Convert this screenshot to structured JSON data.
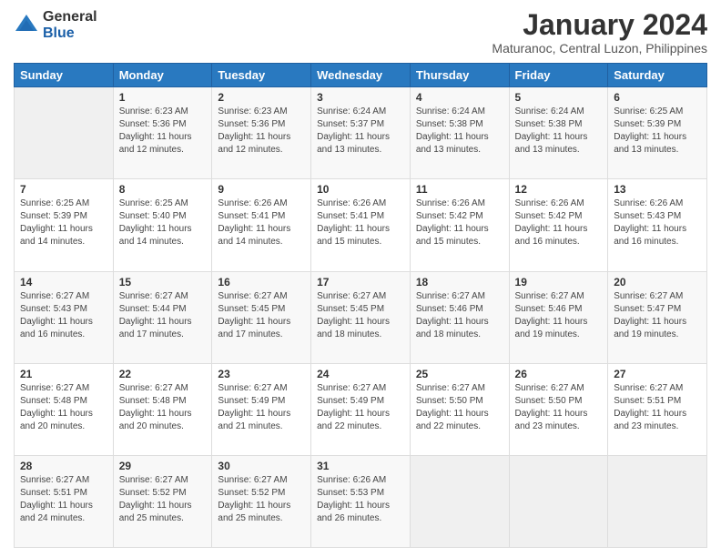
{
  "logo": {
    "general": "General",
    "blue": "Blue"
  },
  "title": "January 2024",
  "subtitle": "Maturanoc, Central Luzon, Philippines",
  "days_header": [
    "Sunday",
    "Monday",
    "Tuesday",
    "Wednesday",
    "Thursday",
    "Friday",
    "Saturday"
  ],
  "weeks": [
    [
      {
        "num": "",
        "info": ""
      },
      {
        "num": "1",
        "info": "Sunrise: 6:23 AM\nSunset: 5:36 PM\nDaylight: 11 hours\nand 12 minutes."
      },
      {
        "num": "2",
        "info": "Sunrise: 6:23 AM\nSunset: 5:36 PM\nDaylight: 11 hours\nand 12 minutes."
      },
      {
        "num": "3",
        "info": "Sunrise: 6:24 AM\nSunset: 5:37 PM\nDaylight: 11 hours\nand 13 minutes."
      },
      {
        "num": "4",
        "info": "Sunrise: 6:24 AM\nSunset: 5:38 PM\nDaylight: 11 hours\nand 13 minutes."
      },
      {
        "num": "5",
        "info": "Sunrise: 6:24 AM\nSunset: 5:38 PM\nDaylight: 11 hours\nand 13 minutes."
      },
      {
        "num": "6",
        "info": "Sunrise: 6:25 AM\nSunset: 5:39 PM\nDaylight: 11 hours\nand 13 minutes."
      }
    ],
    [
      {
        "num": "7",
        "info": "Sunrise: 6:25 AM\nSunset: 5:39 PM\nDaylight: 11 hours\nand 14 minutes."
      },
      {
        "num": "8",
        "info": "Sunrise: 6:25 AM\nSunset: 5:40 PM\nDaylight: 11 hours\nand 14 minutes."
      },
      {
        "num": "9",
        "info": "Sunrise: 6:26 AM\nSunset: 5:41 PM\nDaylight: 11 hours\nand 14 minutes."
      },
      {
        "num": "10",
        "info": "Sunrise: 6:26 AM\nSunset: 5:41 PM\nDaylight: 11 hours\nand 15 minutes."
      },
      {
        "num": "11",
        "info": "Sunrise: 6:26 AM\nSunset: 5:42 PM\nDaylight: 11 hours\nand 15 minutes."
      },
      {
        "num": "12",
        "info": "Sunrise: 6:26 AM\nSunset: 5:42 PM\nDaylight: 11 hours\nand 16 minutes."
      },
      {
        "num": "13",
        "info": "Sunrise: 6:26 AM\nSunset: 5:43 PM\nDaylight: 11 hours\nand 16 minutes."
      }
    ],
    [
      {
        "num": "14",
        "info": "Sunrise: 6:27 AM\nSunset: 5:43 PM\nDaylight: 11 hours\nand 16 minutes."
      },
      {
        "num": "15",
        "info": "Sunrise: 6:27 AM\nSunset: 5:44 PM\nDaylight: 11 hours\nand 17 minutes."
      },
      {
        "num": "16",
        "info": "Sunrise: 6:27 AM\nSunset: 5:45 PM\nDaylight: 11 hours\nand 17 minutes."
      },
      {
        "num": "17",
        "info": "Sunrise: 6:27 AM\nSunset: 5:45 PM\nDaylight: 11 hours\nand 18 minutes."
      },
      {
        "num": "18",
        "info": "Sunrise: 6:27 AM\nSunset: 5:46 PM\nDaylight: 11 hours\nand 18 minutes."
      },
      {
        "num": "19",
        "info": "Sunrise: 6:27 AM\nSunset: 5:46 PM\nDaylight: 11 hours\nand 19 minutes."
      },
      {
        "num": "20",
        "info": "Sunrise: 6:27 AM\nSunset: 5:47 PM\nDaylight: 11 hours\nand 19 minutes."
      }
    ],
    [
      {
        "num": "21",
        "info": "Sunrise: 6:27 AM\nSunset: 5:48 PM\nDaylight: 11 hours\nand 20 minutes."
      },
      {
        "num": "22",
        "info": "Sunrise: 6:27 AM\nSunset: 5:48 PM\nDaylight: 11 hours\nand 20 minutes."
      },
      {
        "num": "23",
        "info": "Sunrise: 6:27 AM\nSunset: 5:49 PM\nDaylight: 11 hours\nand 21 minutes."
      },
      {
        "num": "24",
        "info": "Sunrise: 6:27 AM\nSunset: 5:49 PM\nDaylight: 11 hours\nand 22 minutes."
      },
      {
        "num": "25",
        "info": "Sunrise: 6:27 AM\nSunset: 5:50 PM\nDaylight: 11 hours\nand 22 minutes."
      },
      {
        "num": "26",
        "info": "Sunrise: 6:27 AM\nSunset: 5:50 PM\nDaylight: 11 hours\nand 23 minutes."
      },
      {
        "num": "27",
        "info": "Sunrise: 6:27 AM\nSunset: 5:51 PM\nDaylight: 11 hours\nand 23 minutes."
      }
    ],
    [
      {
        "num": "28",
        "info": "Sunrise: 6:27 AM\nSunset: 5:51 PM\nDaylight: 11 hours\nand 24 minutes."
      },
      {
        "num": "29",
        "info": "Sunrise: 6:27 AM\nSunset: 5:52 PM\nDaylight: 11 hours\nand 25 minutes."
      },
      {
        "num": "30",
        "info": "Sunrise: 6:27 AM\nSunset: 5:52 PM\nDaylight: 11 hours\nand 25 minutes."
      },
      {
        "num": "31",
        "info": "Sunrise: 6:26 AM\nSunset: 5:53 PM\nDaylight: 11 hours\nand 26 minutes."
      },
      {
        "num": "",
        "info": ""
      },
      {
        "num": "",
        "info": ""
      },
      {
        "num": "",
        "info": ""
      }
    ]
  ]
}
